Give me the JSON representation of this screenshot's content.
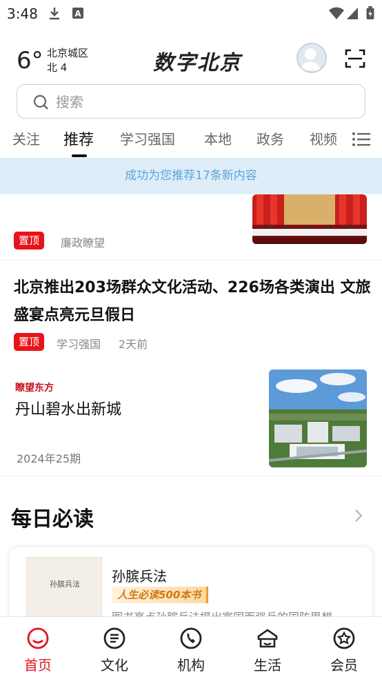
{
  "status_bar": {
    "time": "3:48"
  },
  "header": {
    "temperature": "6°",
    "district": "北京城区",
    "wind": "北 4",
    "app_title": "数字北京"
  },
  "search": {
    "placeholder": "搜索"
  },
  "tabs": [
    "关注",
    "推荐",
    "学习强国",
    "本地",
    "政务",
    "视频"
  ],
  "active_tab": "推荐",
  "notice": "成功为您推荐17条新内容",
  "articles": [
    {
      "pinned": "置顶",
      "source": "廉政瞭望"
    },
    {
      "title": "北京推出203场群众文化活动、226场各类演出 文旅盛宴点亮元旦假日",
      "pinned": "置顶",
      "source": "学习强国",
      "time": "2天前"
    },
    {
      "brand": "瞭望东方",
      "title": "丹山碧水出新城",
      "issue": "2024年25期"
    }
  ],
  "daily_read": {
    "title": "每日必读",
    "book": {
      "cover_title": "孙膑兵法",
      "title": "孙膑兵法",
      "badge": "人生必读500本书",
      "description": "图书亮点孙膑兵法提出富国而强兵的国防思想"
    }
  },
  "bottom_nav": [
    {
      "label": "首页",
      "icon": "home-icon",
      "active": true
    },
    {
      "label": "文化",
      "icon": "culture-icon",
      "active": false
    },
    {
      "label": "机构",
      "icon": "phone-icon",
      "active": false
    },
    {
      "label": "生活",
      "icon": "life-icon",
      "active": false
    },
    {
      "label": "会员",
      "icon": "member-icon",
      "active": false
    }
  ],
  "colors": {
    "accent": "#e0141c",
    "notice_bg": "#deedf8",
    "notice_text": "#5aa5dc"
  }
}
